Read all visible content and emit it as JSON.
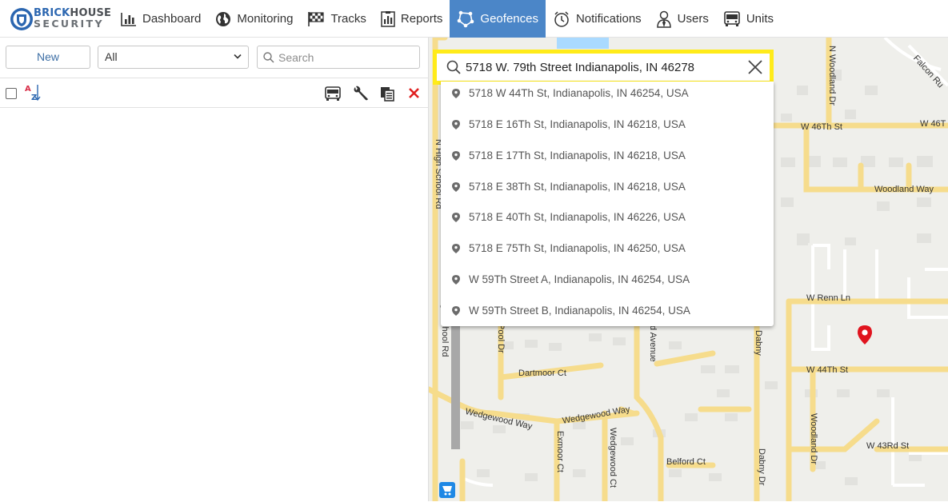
{
  "brand": {
    "line1_a": "BRICK",
    "line1_b": "HOUSE",
    "line2": "SECURITY"
  },
  "nav": [
    {
      "label": "Dashboard",
      "icon": "bar-chart-icon",
      "active": false
    },
    {
      "label": "Monitoring",
      "icon": "globe-icon",
      "active": false
    },
    {
      "label": "Tracks",
      "icon": "checkered-flag-icon",
      "active": false
    },
    {
      "label": "Reports",
      "icon": "report-icon",
      "active": false
    },
    {
      "label": "Geofences",
      "icon": "geofence-icon",
      "active": true
    },
    {
      "label": "Notifications",
      "icon": "alarm-clock-icon",
      "active": false
    },
    {
      "label": "Users",
      "icon": "user-icon",
      "active": false
    },
    {
      "label": "Units",
      "icon": "bus-icon",
      "active": false
    }
  ],
  "left_panel": {
    "new_label": "New",
    "filter_value": "All",
    "search_placeholder": "Search"
  },
  "map_search": {
    "query": "5718 W. 79th Street Indianapolis, IN 46278",
    "suggestions": [
      "5718 W 44Th St, Indianapolis, IN 46254, USA",
      "5718 E 16Th St, Indianapolis, IN 46218, USA",
      "5718 E 17Th St, Indianapolis, IN 46218, USA",
      "5718 E 38Th St, Indianapolis, IN 46218, USA",
      "5718 E 40Th St, Indianapolis, IN 46226, USA",
      "5718 E 75Th St, Indianapolis, IN 46250, USA",
      "W 59Th Street A, Indianapolis, IN 46254, USA",
      "W 59Th Street B, Indianapolis, IN 46254, USA"
    ]
  },
  "map_labels": {
    "w46": "W 46Th St",
    "w46b": "W 46T",
    "woodland_way": "Woodland Way",
    "w_renn": "W Renn Ln",
    "w44": "W 44Th St",
    "w43": "W 43Rd St",
    "dartmoor": "Dartmoor Ct",
    "wedgewood_way": "Wedgewood Way",
    "wedgewood_way2": "Wedgewood Way",
    "belford": "Belford Ct",
    "n_woodland": "N Woodland Dr",
    "falcon": "Falcon Ru",
    "high_school": "N High School Rd",
    "high_school2": "N High School Rd",
    "exmoor": "Exmoor Ct",
    "wedgewood_ct": "Wedgewood Ct",
    "dabny": "Dabny Dr",
    "dabny2": "Dabny",
    "woodland_dr": "Woodland Dr",
    "avenue": "d Avenue",
    "pool": "Pool Dr"
  },
  "colors": {
    "accent": "#4b86c8",
    "highlight": "#ffeb1a",
    "pin": "#e0141e",
    "road": "#f5d98a"
  }
}
